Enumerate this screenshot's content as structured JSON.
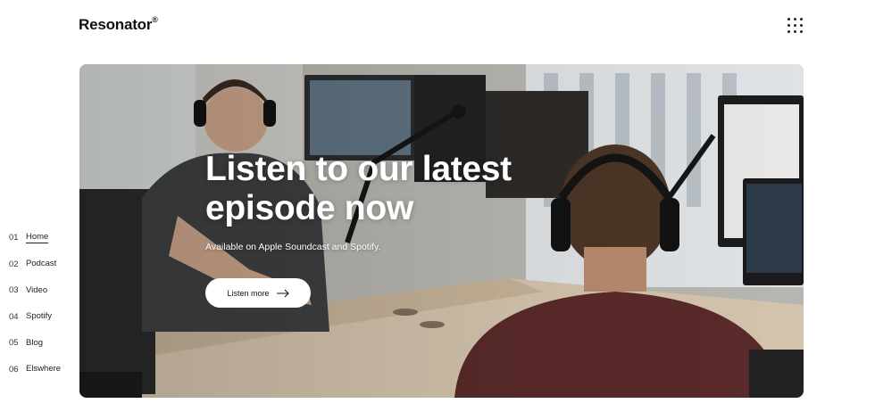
{
  "header": {
    "brand": "Resonator",
    "brand_mark": "®",
    "menu_icon": "grid-dots-icon"
  },
  "nav": {
    "items": [
      {
        "num": "01",
        "label": "Home",
        "active": true
      },
      {
        "num": "02",
        "label": "Podcast",
        "active": false
      },
      {
        "num": "03",
        "label": "Video",
        "active": false
      },
      {
        "num": "04",
        "label": "Spotify",
        "active": false
      },
      {
        "num": "05",
        "label": "Blog",
        "active": false
      },
      {
        "num": "06",
        "label": "Elswhere",
        "active": false
      }
    ]
  },
  "hero": {
    "title_line1": "Listen to our latest",
    "title_line2": "episode now",
    "subtitle": "Available on Apple Soundcast and Spotify.",
    "cta_label": "Listen more",
    "cta_icon": "arrow-right-icon"
  }
}
